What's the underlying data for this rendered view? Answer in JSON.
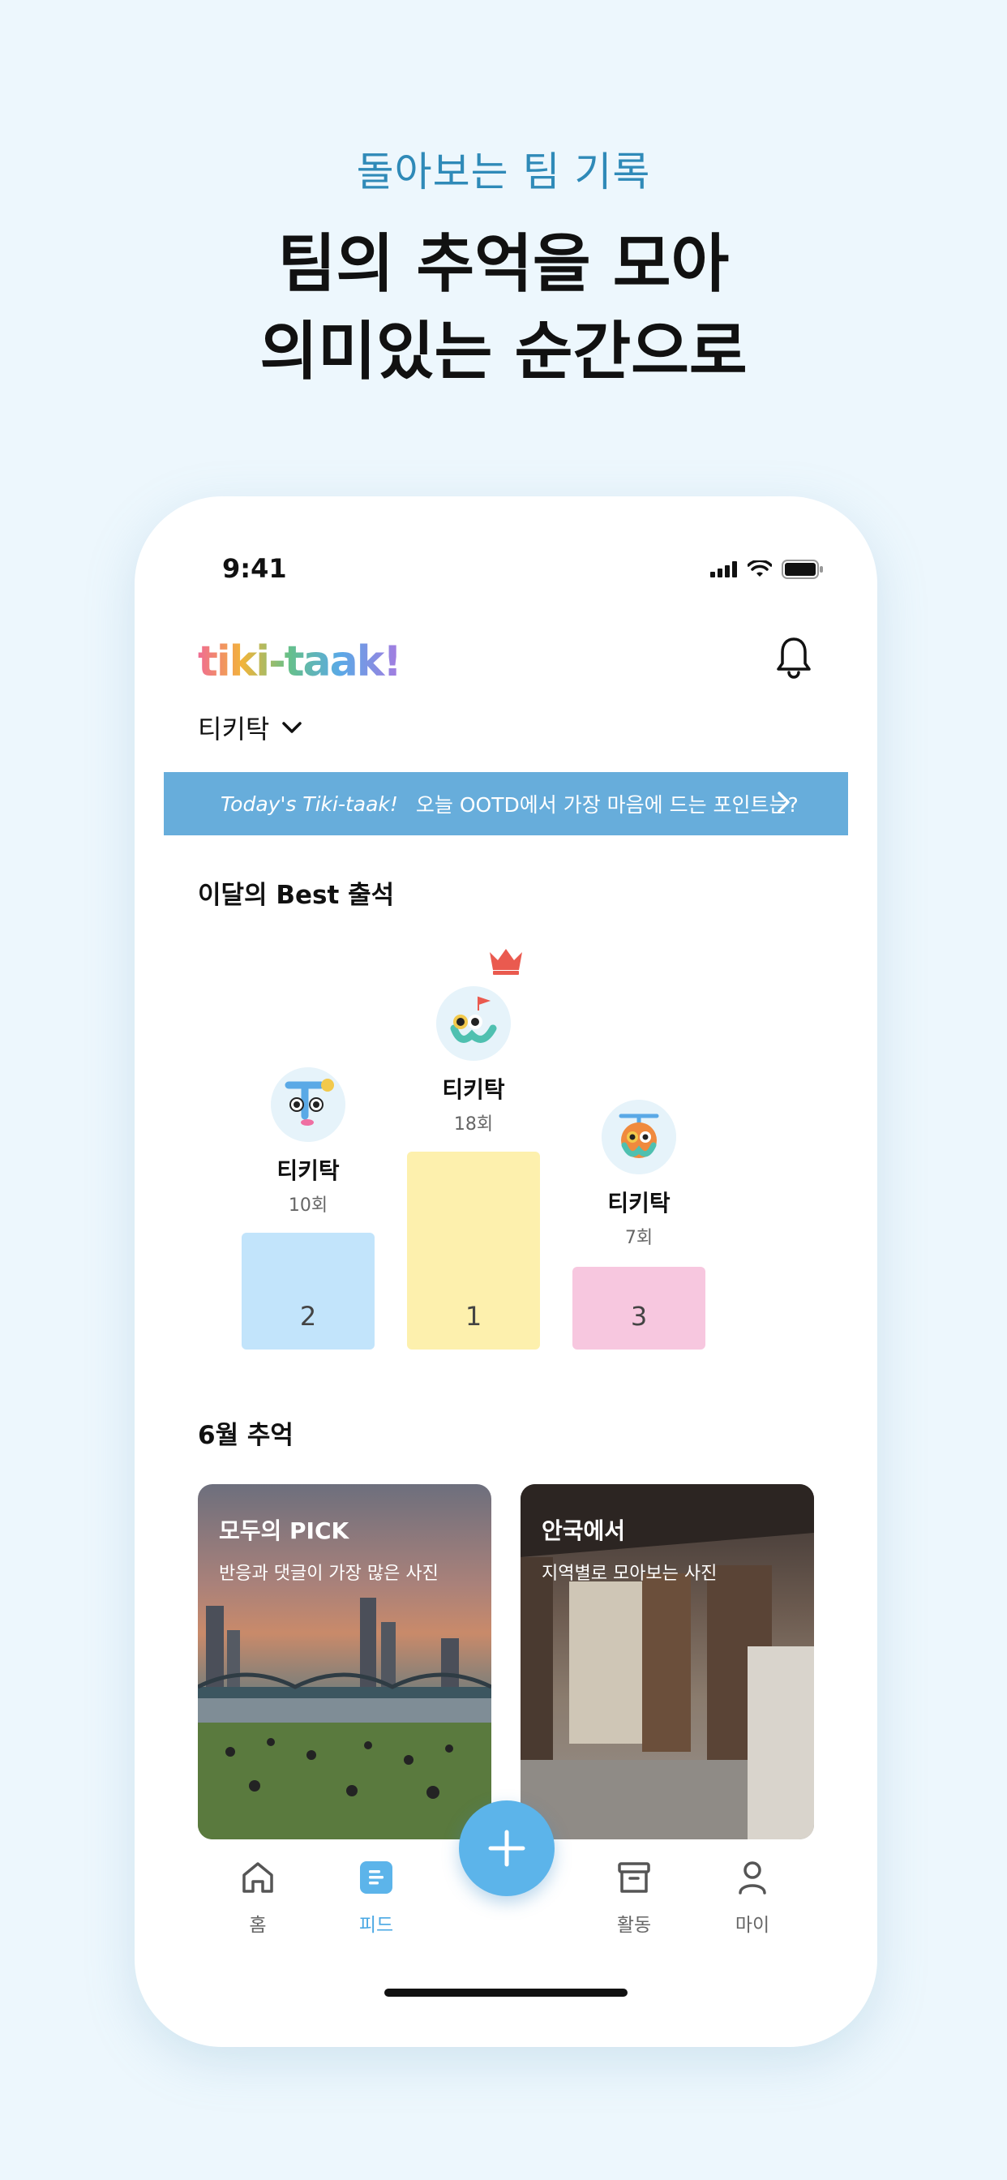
{
  "promo": {
    "subtitle": "돌아보는 팀 기록",
    "title_line1": "팀의 추억을 모아",
    "title_line2": "의미있는 순간으로"
  },
  "status_bar": {
    "time": "9:41"
  },
  "header": {
    "logo": "tiki-taak!",
    "team_name": "티키탁"
  },
  "today_banner": {
    "brand": "Today's Tiki-taak!",
    "question": "오늘 OOTD에서 가장 마음에 드는 포인트는?"
  },
  "best_attendance": {
    "title": "이달의 Best 출석",
    "ranks": [
      {
        "rank": "1",
        "name": "티키탁",
        "count": "18회",
        "color": "#fdf0ad"
      },
      {
        "rank": "2",
        "name": "티키탁",
        "count": "10회",
        "color": "#c2e4fb"
      },
      {
        "rank": "3",
        "name": "티키탁",
        "count": "7회",
        "color": "#f7c7df"
      }
    ],
    "crown_color": "#ea5a4f"
  },
  "memories": {
    "title": "6월 추억",
    "cards": [
      {
        "title": "모두의 PICK",
        "desc": "반응과 댓글이 가장 많은 사진"
      },
      {
        "title": "안국에서",
        "desc": "지역별로 모아보는 사진"
      }
    ]
  },
  "tabbar": {
    "home": "홈",
    "feed": "피드",
    "activity": "활동",
    "my": "마이",
    "active_color": "#4aa8e4"
  }
}
